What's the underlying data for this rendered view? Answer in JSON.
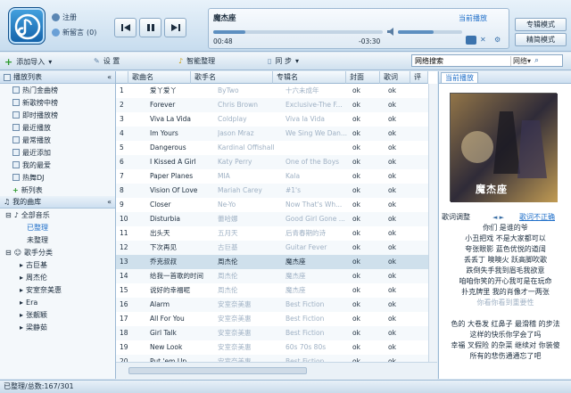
{
  "user": {
    "login": "注册",
    "messages": "新留言",
    "msg_count": "(0)"
  },
  "now_playing": {
    "title": "魔杰座",
    "status": "当前播放",
    "elapsed": "00:48",
    "remaining": "-03:30",
    "progress": 0.19,
    "volume": 0.55
  },
  "modes": {
    "expert": "专辑模式",
    "compact": "精简模式"
  },
  "toolbar": {
    "add": "添加导入",
    "settings": "设 置",
    "organize": "智能整理",
    "sync": "同 步"
  },
  "search": {
    "value": "网络搜索",
    "scope": "网络"
  },
  "sidebar": {
    "playlist_header": "播放列表",
    "playlists": [
      "热门金曲榜",
      "新歌榜中榜",
      "即时播放榜",
      "最近播放",
      "最常播放",
      "最近添加",
      "我的最爱",
      "热舞DJ"
    ],
    "new_list": "新列表",
    "library": "我的曲库",
    "all_music": "全部音乐",
    "organized": "已整理",
    "unorganized": "未整理",
    "artist_cat": "歌手分类",
    "artists": [
      "古巨基",
      "周杰伦",
      "安室奈美惠",
      "Era",
      "张靓颖",
      "梁静茹"
    ]
  },
  "table": {
    "columns": [
      "歌曲名",
      "歌手名",
      "专辑名",
      "封面",
      "歌词",
      "评"
    ],
    "rows": [
      [
        "1",
        "爱丫爱丫",
        "ByTwo",
        "十六未成年",
        "ok",
        "ok"
      ],
      [
        "2",
        "Forever",
        "Chris Brown",
        "Exclusive-The F...",
        "ok",
        "ok"
      ],
      [
        "3",
        "Viva La Vida",
        "Coldplay",
        "Viva la Vida",
        "ok",
        "ok"
      ],
      [
        "4",
        "Im Yours",
        "Jason Mraz",
        "We Sing We Dan...",
        "ok",
        "ok"
      ],
      [
        "5",
        "Dangerous",
        "Kardinal Offishall",
        "",
        "ok",
        "ok"
      ],
      [
        "6",
        "I Kissed A Girl",
        "Katy Perry",
        "One of the Boys",
        "ok",
        "ok"
      ],
      [
        "7",
        "Paper Planes",
        "MIA",
        "Kala",
        "ok",
        "ok"
      ],
      [
        "8",
        "Vision Of Love",
        "Mariah Carey",
        "#1's",
        "ok",
        "ok"
      ],
      [
        "9",
        "Closer",
        "Ne-Yo",
        "Now That's Wh...",
        "ok",
        "ok"
      ],
      [
        "10",
        "Disturbia",
        "蕾哈娜",
        "Good Girl Gone ...",
        "ok",
        "ok"
      ],
      [
        "11",
        "出头天",
        "五月天",
        "后青春期的诗",
        "ok",
        "ok"
      ],
      [
        "12",
        "下次再见",
        "古巨基",
        "Guitar Fever",
        "ok",
        "ok"
      ],
      [
        "13",
        "乔克叔叔",
        "周杰伦",
        "魔杰座",
        "ok",
        "ok"
      ],
      [
        "14",
        "给我一首歌的时间",
        "周杰伦",
        "魔杰座",
        "ok",
        "ok"
      ],
      [
        "15",
        "说好的幸福呢",
        "周杰伦",
        "魔杰座",
        "ok",
        "ok"
      ],
      [
        "16",
        "Alarm",
        "安室奈美惠",
        "Best Fiction",
        "ok",
        "ok"
      ],
      [
        "17",
        "All For You",
        "安室奈美惠",
        "Best Fiction",
        "ok",
        "ok"
      ],
      [
        "18",
        "Girl Talk",
        "安室奈美惠",
        "Best Fiction",
        "ok",
        "ok"
      ],
      [
        "19",
        "New Look",
        "安室奈美惠",
        "60s 70s 80s",
        "ok",
        "ok"
      ],
      [
        "20",
        "Put 'em Up",
        "安室奈美惠",
        "Best Fiction",
        "ok",
        "ok"
      ]
    ],
    "selected_row": 12
  },
  "right_panel": {
    "tab": "当前播放",
    "cover_caption": "魔杰座",
    "lyric_adjust": "歌词调整",
    "lyric_wrong": "歌词不正确",
    "lyrics": [
      "你们 是谁的爷",
      "小丑把戏 不是大家都可以",
      "夸张眼影 蓝色优悦的道阔",
      "丢丢丁 噢噢火 跃高脚吹歌",
      "跌倒失手我到眉毛我欲意",
      "咱咱你笑的开心我可是在玩命",
      "扑克牌里 我的肖像才一两张",
      "你看你看到重要性",
      "",
      "色的 大卷发 红鼻子 最滑稽 的步法",
      "这样的快乐你学会了吗",
      "幸福 叉假险 的杂菜 继续对 你装傻",
      "所有的悲伤通通忘了吧"
    ]
  },
  "status": "已整理/总数:167/301",
  "colors": {
    "accent": "#1a6fb8",
    "link": "#1f6fc9",
    "selected_row": "#cfe0ec",
    "gray_text": "#9fb1c4"
  }
}
